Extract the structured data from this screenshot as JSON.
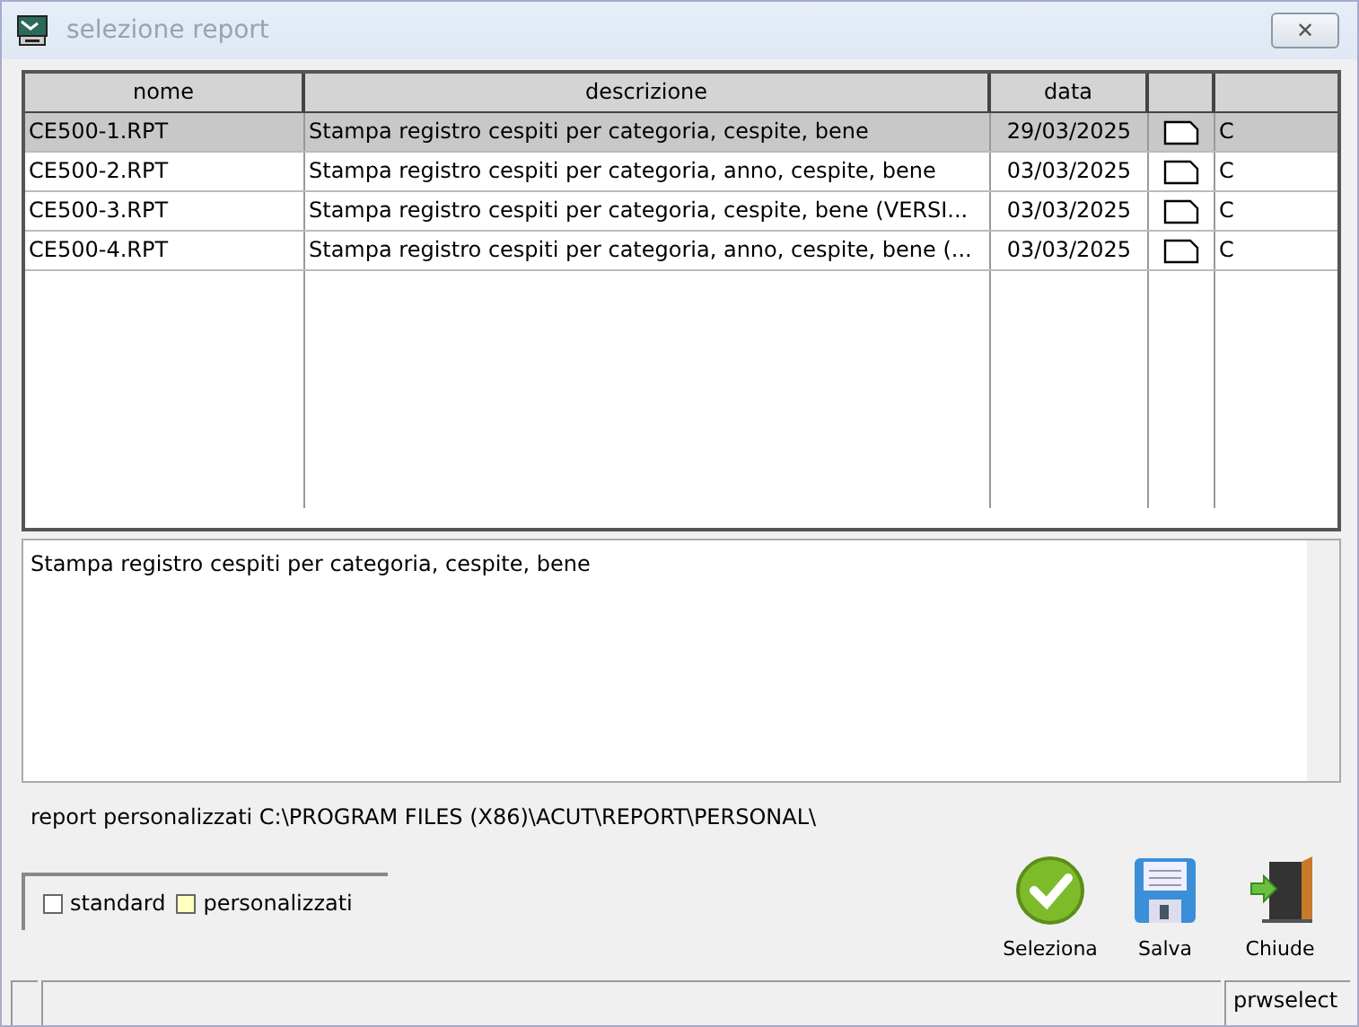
{
  "window": {
    "title": "selezione report",
    "close": "✕"
  },
  "table": {
    "columns": [
      "nome",
      "descrizione",
      "data"
    ],
    "rows": [
      {
        "nome": "CE500-1.RPT",
        "descrizione": "Stampa registro cespiti per categoria, cespite, bene",
        "data": "29/03/2025",
        "column_5": "C",
        "selected": true
      },
      {
        "nome": "CE500-2.RPT",
        "descrizione": "Stampa registro cespiti per categoria, anno, cespite, bene",
        "data": "03/03/2025",
        "column_5": "C",
        "selected": false
      },
      {
        "nome": "CE500-3.RPT",
        "descrizione": "Stampa registro cespiti per categoria, cespite, bene (VERSI...",
        "data": "03/03/2025",
        "column_5": "C",
        "selected": false
      },
      {
        "nome": "CE500-4.RPT",
        "descrizione": "Stampa registro cespiti per categoria, anno, cespite, bene (...",
        "data": "03/03/2025",
        "column_5": "C",
        "selected": false
      }
    ]
  },
  "description": "Stampa registro cespiti per categoria, cespite, bene",
  "path": "report personalizzati C:\\PROGRAM FILES (X86)\\ACUT\\REPORT\\PERSONAL\\",
  "legend": [
    {
      "label": "standard",
      "color": "#ffffff"
    },
    {
      "label": "personalizzati",
      "color": "#ffffc0"
    }
  ],
  "buttons": [
    {
      "label": "Seleziona",
      "kind": "select"
    },
    {
      "label": "Salva",
      "kind": "save"
    },
    {
      "label": "Chiude",
      "kind": "exit"
    }
  ],
  "status_bar": {
    "program": "prwselect"
  }
}
